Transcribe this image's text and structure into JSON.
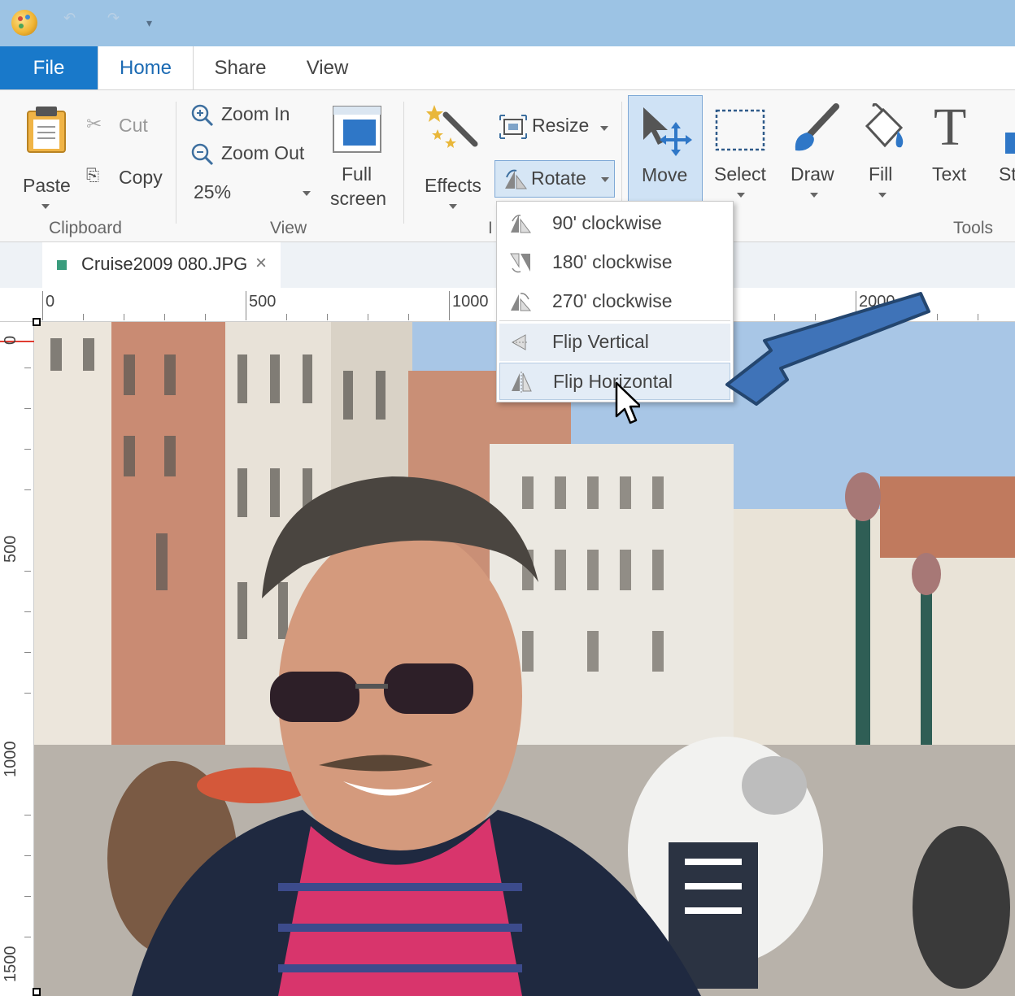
{
  "tabs": {
    "file": "File",
    "home": "Home",
    "share": "Share",
    "view": "View"
  },
  "ribbon": {
    "clipboard": {
      "paste": "Paste",
      "cut": "Cut",
      "copy": "Copy",
      "group_label": "Clipboard"
    },
    "view": {
      "zoom_in": "Zoom In",
      "zoom_out": "Zoom Out",
      "zoom_level": "25%",
      "full_screen_line1": "Full",
      "full_screen_line2": "screen",
      "group_label": "View"
    },
    "image": {
      "effects": "Effects",
      "resize": "Resize",
      "rotate": "Rotate",
      "group_label": "I"
    },
    "tools": {
      "move": "Move",
      "select": "Select",
      "draw": "Draw",
      "fill": "Fill",
      "text": "Text",
      "stamp": "St",
      "group_label": "Tools"
    }
  },
  "rotate_menu": {
    "items": [
      {
        "label": "90' clockwise"
      },
      {
        "label": "180' clockwise"
      },
      {
        "label": "270' clockwise"
      },
      {
        "label": "Flip Vertical"
      },
      {
        "label": "Flip Horizontal"
      }
    ]
  },
  "document": {
    "tab_name": "Cruise2009 080.JPG",
    "close_glyph": "×"
  },
  "ruler": {
    "h_labels": [
      "0",
      "500",
      "1000",
      "2000"
    ],
    "v_labels": [
      "0",
      "500",
      "1000",
      "1500"
    ]
  },
  "colors": {
    "accent": "#1979ca",
    "titlebar": "#9cc3e4",
    "arrow": "#3f73b8"
  }
}
